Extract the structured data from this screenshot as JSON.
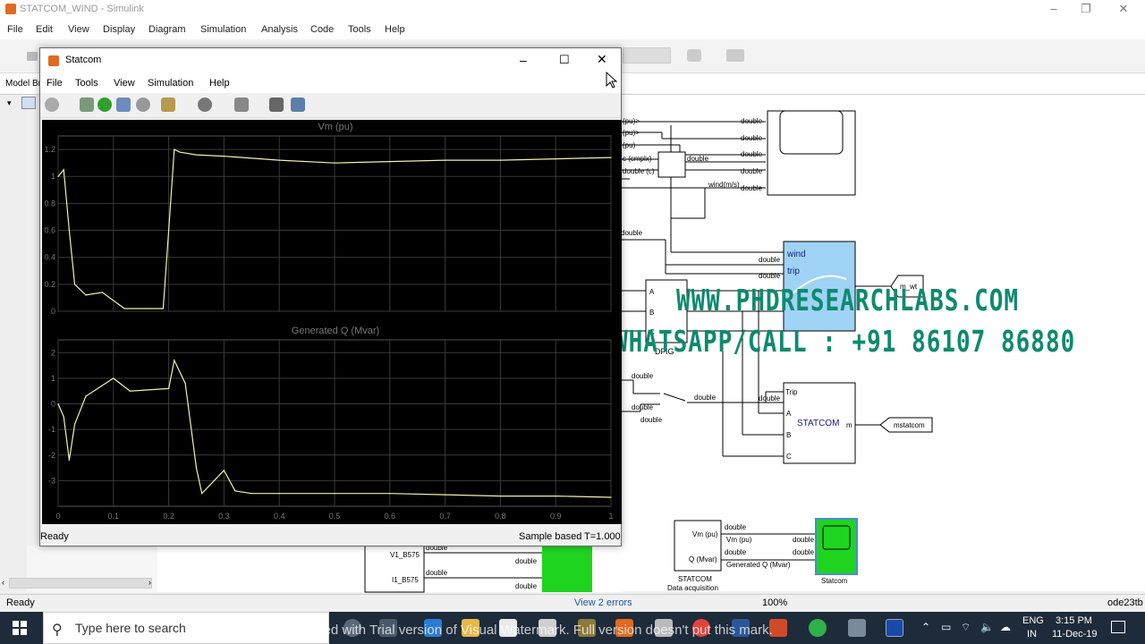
{
  "bg_window": {
    "title": "STATCOM_WIND - Simulink",
    "menu": [
      "File",
      "Edit",
      "View",
      "Display",
      "Diagram",
      "Simulation",
      "Analysis",
      "Code",
      "Tools",
      "Help"
    ],
    "model_browser_label": "Model Br",
    "status_left": "Ready",
    "status_errors": "View 2 errors",
    "status_zoom": "100%",
    "status_solver": "ode23tb"
  },
  "scope": {
    "title": "Statcom",
    "menu": [
      "File",
      "Tools",
      "View",
      "Simulation",
      "Help"
    ],
    "status_ready": "Ready",
    "status_sample": "Sample based",
    "status_time": "T=1.000"
  },
  "chart_data": [
    {
      "type": "line",
      "title": "Vm (pu)",
      "x": [
        0,
        0.01,
        0.02,
        0.03,
        0.05,
        0.08,
        0.12,
        0.16,
        0.19,
        0.2,
        0.21,
        0.22,
        0.25,
        0.3,
        0.4,
        0.5,
        0.6,
        0.7,
        0.8,
        0.9,
        1.0
      ],
      "values": [
        1.0,
        1.05,
        0.6,
        0.2,
        0.12,
        0.14,
        0.02,
        0.02,
        0.02,
        0.6,
        1.2,
        1.18,
        1.16,
        1.15,
        1.12,
        1.1,
        1.11,
        1.12,
        1.12,
        1.13,
        1.14
      ],
      "xlim": [
        0,
        1
      ],
      "ylim": [
        0,
        1.3
      ],
      "xticks": [
        "0",
        "0.1",
        "0.2",
        "0.3",
        "0.4",
        "0.5",
        "0.6",
        "0.7",
        "0.8",
        "0.9",
        "1"
      ],
      "yticks": [
        "0",
        "0.2",
        "0.4",
        "0.6",
        "0.8",
        "1",
        "1.2"
      ],
      "grid": true
    },
    {
      "type": "line",
      "title": "Generated Q (Mvar)",
      "x": [
        0,
        0.01,
        0.02,
        0.03,
        0.05,
        0.1,
        0.13,
        0.2,
        0.21,
        0.23,
        0.25,
        0.26,
        0.3,
        0.32,
        0.35,
        0.4,
        0.5,
        0.6,
        0.7,
        0.8,
        0.9,
        1.0
      ],
      "values": [
        0,
        -0.5,
        -2.2,
        -0.8,
        0.3,
        1.0,
        0.5,
        0.6,
        1.7,
        0.8,
        -2.5,
        -3.5,
        -2.6,
        -3.4,
        -3.5,
        -3.5,
        -3.5,
        -3.5,
        -3.55,
        -3.6,
        -3.6,
        -3.65
      ],
      "xlim": [
        0,
        1
      ],
      "ylim": [
        -4,
        2.5
      ],
      "xticks": [
        "0",
        "0.1",
        "0.2",
        "0.3",
        "0.4",
        "0.5",
        "0.6",
        "0.7",
        "0.8",
        "0.9",
        "1"
      ],
      "yticks": [
        "-3",
        "-2",
        "-1",
        "0",
        "1",
        "2"
      ],
      "grid": true
    }
  ],
  "diagram": {
    "labels": {
      "pu1": "(pu)>",
      "pu2": "(pu)>",
      "pu3": "(pu)",
      "cmplx": "c (cmplx)",
      "double_o": "double (c)",
      "wind_ms": "wind(m/s)",
      "wind_block_wind": "wind",
      "wind_block_trip": "trip",
      "m_wt": "m_wt",
      "dfig": "DFIG",
      "statcom_block": "STATCOM",
      "trip_in": "Trip",
      "mstatcom": "mstatcom",
      "vm_pu_in": "Vm (pu)",
      "q_mvar_in": "Q (Mvar)",
      "vm_pu_out": "Vm (pu)",
      "gen_q_out": "Generated Q (Mvar)",
      "acq_line1": "STATCOM",
      "acq_line2": "Data acquisition",
      "scope_label": "Statcom",
      "v1": "V1_B575",
      "i1": "I1_B575",
      "port_a": "A",
      "port_b": "B",
      "port_c": "C",
      "port_m": "m",
      "double": "double"
    }
  },
  "watermark": {
    "line1": "WWW.PHDRESEARCHLABS.COM",
    "line2": "WHATSAPP/CALL : +91 86107 86880",
    "bottom": "Protected with Trial version of Visual Watermark. Full version doesn't put this mark."
  },
  "taskbar": {
    "search_placeholder": "Type here to search",
    "lang1": "ENG",
    "lang2": "IN",
    "time": "3:15 PM",
    "date": "11-Dec-19"
  }
}
